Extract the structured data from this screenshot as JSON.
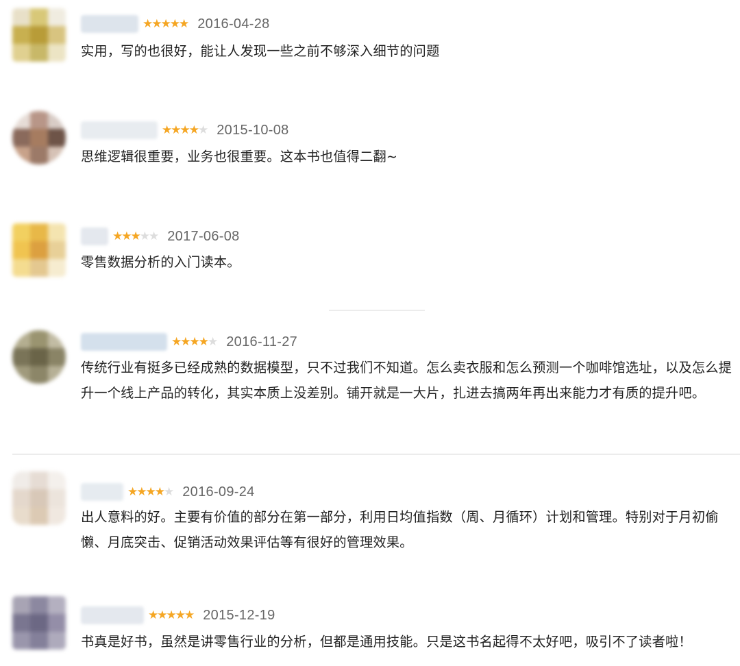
{
  "colors": {
    "star_on": "#f5a623",
    "star_off": "#dddddd",
    "date": "#666666",
    "text": "#222222"
  },
  "reviews": [
    {
      "rating": 5,
      "date": "2016-04-28",
      "text": "实用，写的也很好，能让人发现一些之前不够深入细节的问题"
    },
    {
      "rating": 4,
      "date": "2015-10-08",
      "text": "思维逻辑很重要，业务也很重要。这本书也值得二翻~"
    },
    {
      "rating": 3,
      "date": "2017-06-08",
      "text": "零售数据分析的入门读本。"
    },
    {
      "rating": 4,
      "date": "2016-11-27",
      "text": "传统行业有挺多已经成熟的数据模型，只不过我们不知道。怎么卖衣服和怎么预测一个咖啡馆选址，以及怎么提升一个线上产品的转化，其实本质上没差别。铺开就是一大片，扎进去搞两年再出来能力才有质的提升吧。"
    },
    {
      "rating": 4,
      "date": "2016-09-24",
      "text": "出人意料的好。主要有价值的部分在第一部分，利用日均值指数（周、月循环）计划和管理。特别对于月初偷懒、月底突击、促销活动效果评估等有很好的管理效果。"
    },
    {
      "rating": 5,
      "date": "2015-12-19",
      "text": "书真是好书，虽然是讲零售行业的分析，但都是通用技能。只是这书名起得不太好吧，吸引不了读者啦！"
    }
  ]
}
